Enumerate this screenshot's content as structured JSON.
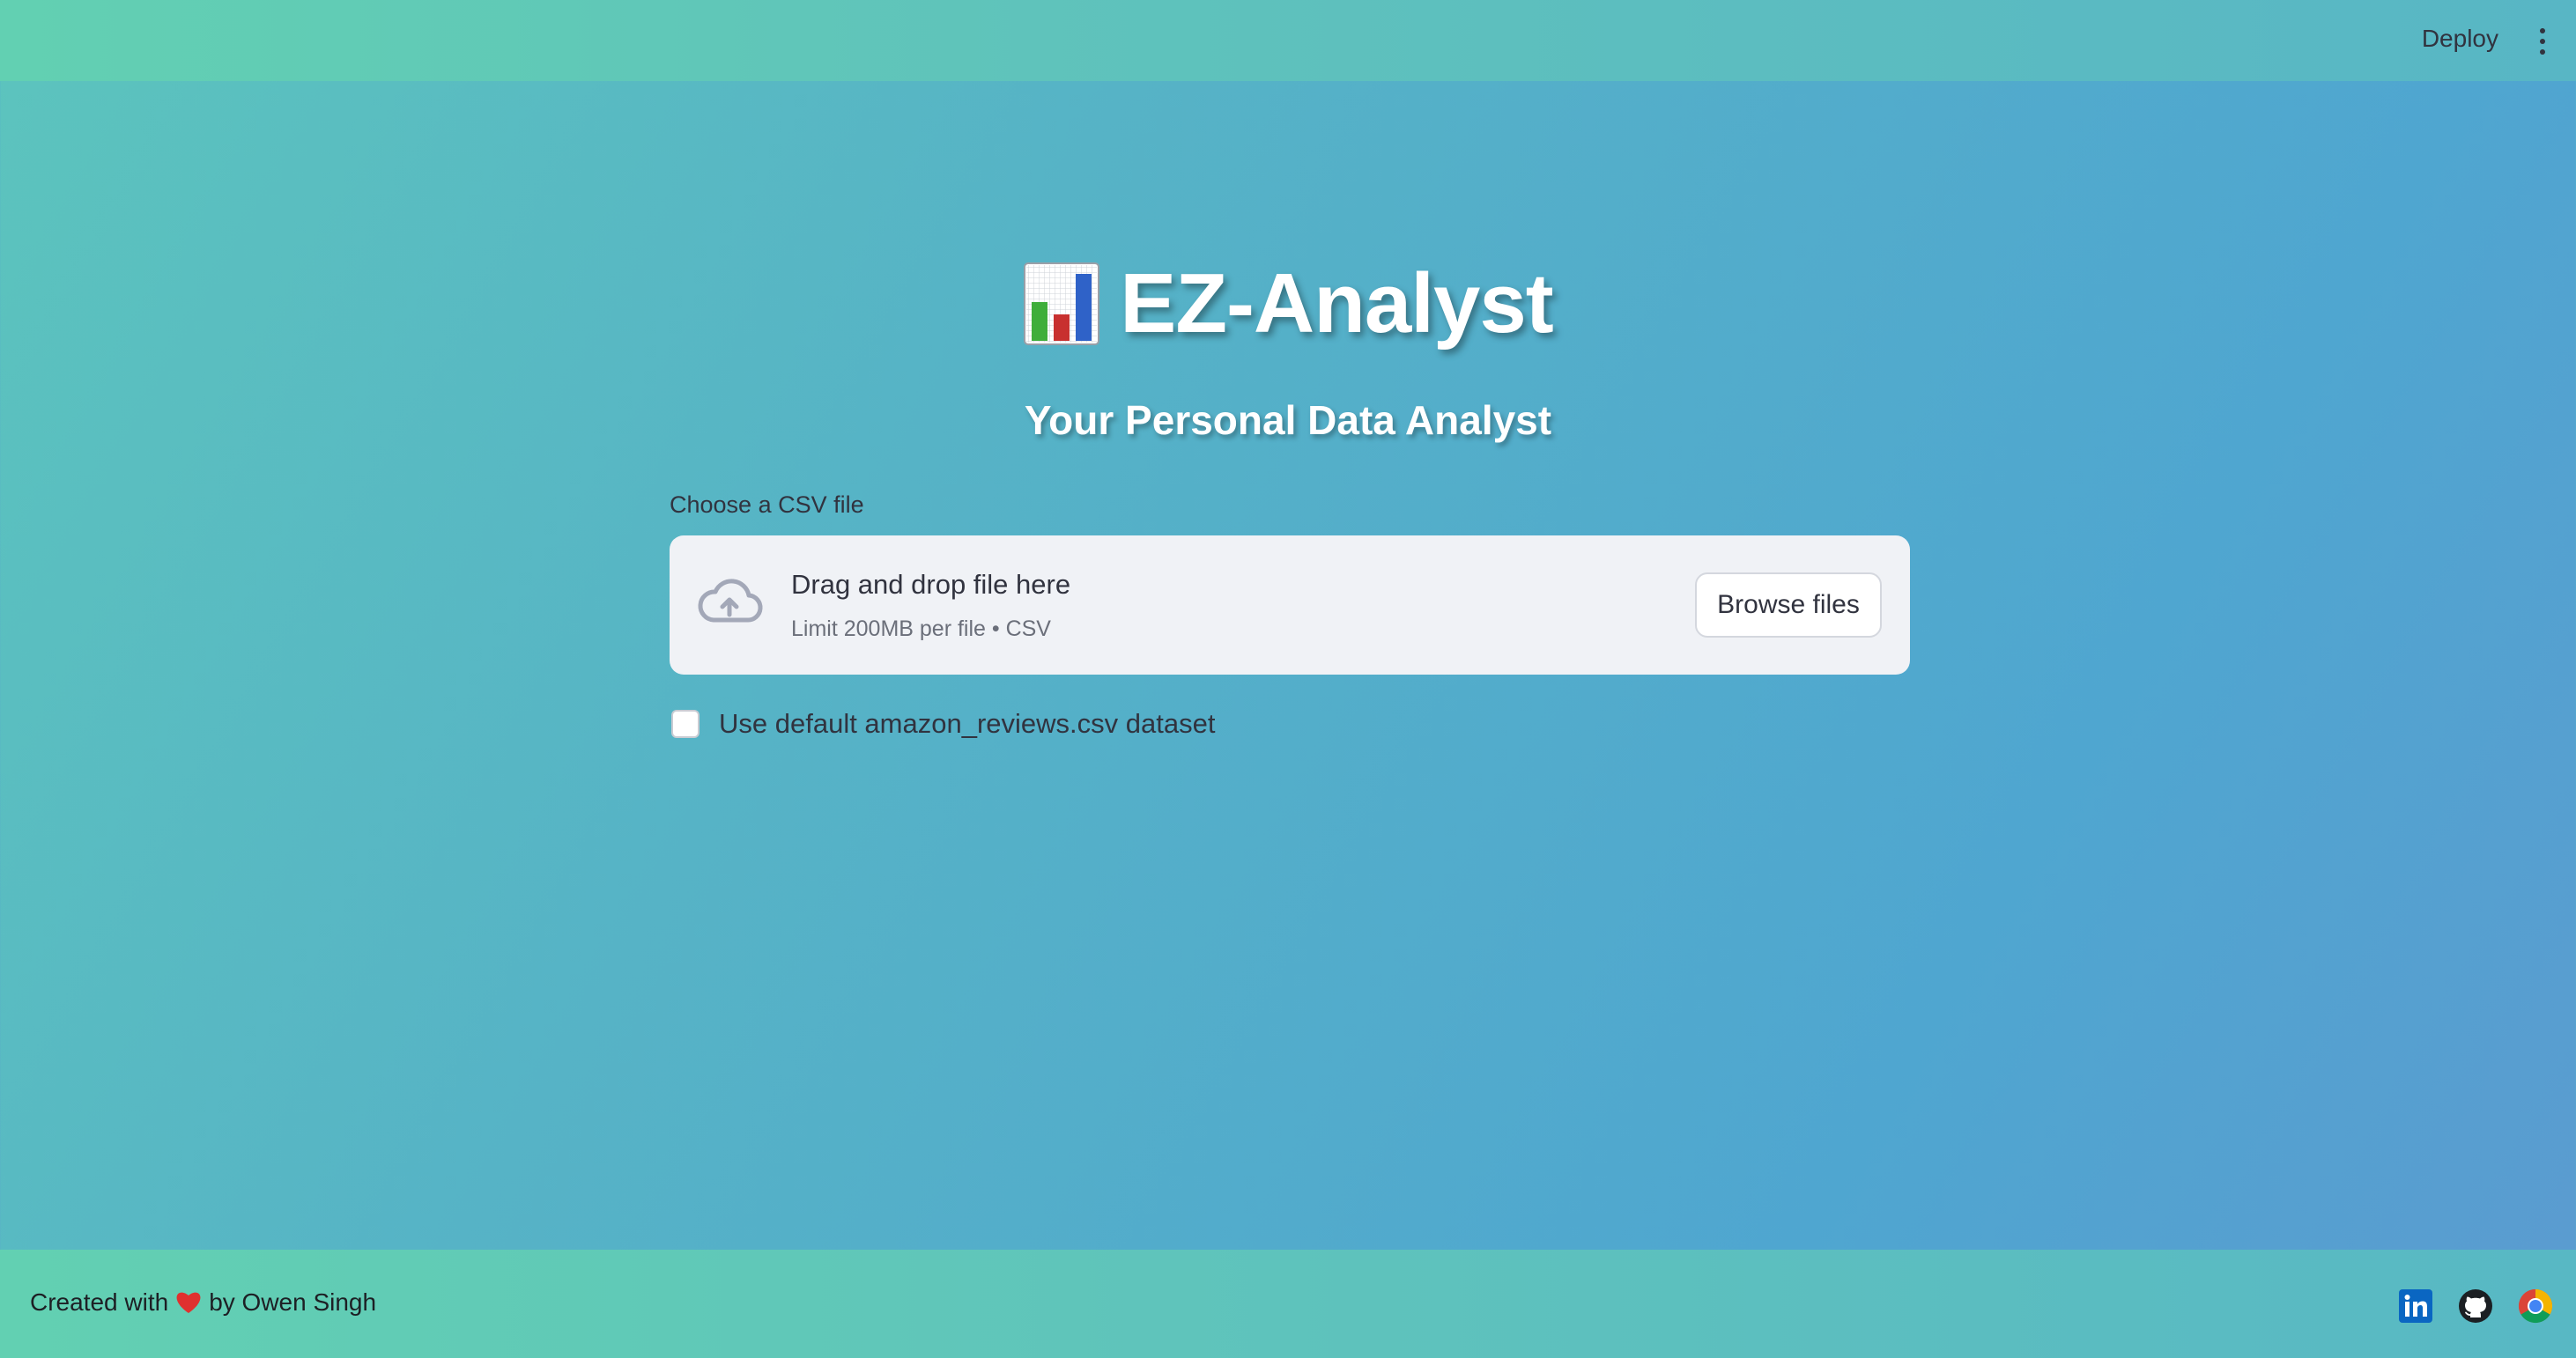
{
  "header": {
    "deploy_label": "Deploy",
    "menu_icon": "kebab-menu-icon"
  },
  "hero": {
    "title": "EZ-Analyst",
    "title_icon": "bar-chart-icon",
    "subtitle": "Your Personal Data Analyst"
  },
  "uploader": {
    "label": "Choose a CSV file",
    "drop_title": "Drag and drop file here",
    "drop_subtitle": "Limit 200MB per file • CSV",
    "browse_label": "Browse files",
    "icon": "cloud-upload-icon"
  },
  "options": {
    "default_dataset_label": "Use default amazon_reviews.csv dataset",
    "default_dataset_checked": false
  },
  "footer": {
    "credit_prefix": "Created with",
    "credit_suffix": "by Owen Singh",
    "heart_icon": "heart-icon",
    "links": [
      "linkedin-icon",
      "github-icon",
      "chrome-icon"
    ]
  },
  "colors": {
    "header_bg": "#62d0b2",
    "page_bg": "#4fa6d0",
    "dropzone_bg": "#f0f2f6",
    "text_dark": "#31333f"
  }
}
